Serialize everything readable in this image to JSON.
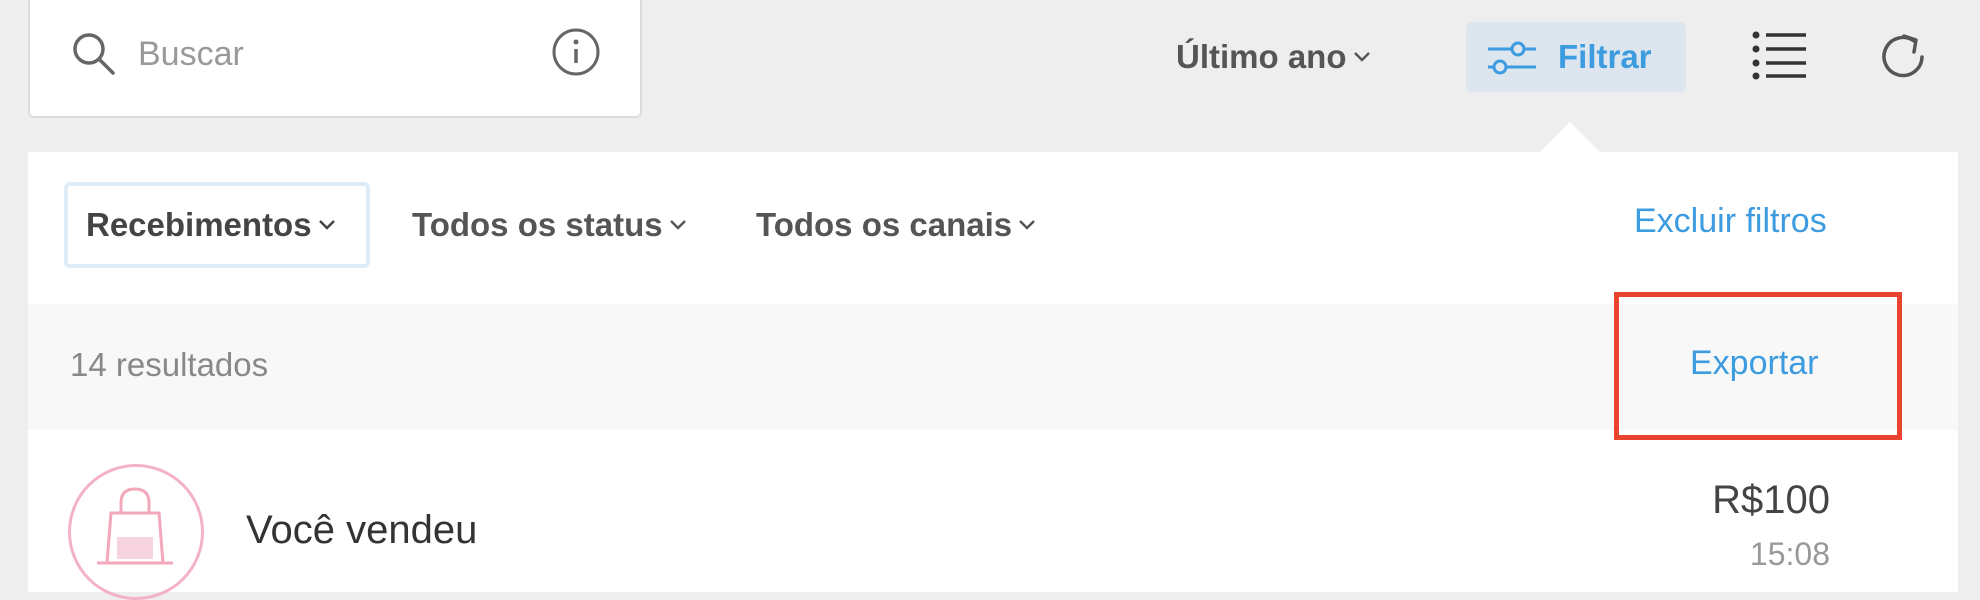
{
  "search": {
    "placeholder": "Buscar"
  },
  "toolbar": {
    "period_label": "Último ano",
    "filter_label": "Filtrar",
    "accent_color": "#3d9be0"
  },
  "filters": {
    "items": [
      {
        "label": "Recebimentos",
        "selected": true
      },
      {
        "label": "Todos os status",
        "selected": false
      },
      {
        "label": "Todos os canais",
        "selected": false
      }
    ],
    "clear_label": "Excluir filtros"
  },
  "results": {
    "count_label": "14 resultados",
    "export_label": "Exportar",
    "highlight_color": "#e8442f"
  },
  "transactions": [
    {
      "icon": "shopping-bag-icon",
      "title": "Você vendeu",
      "amount": "R$100",
      "time": "15:08"
    }
  ]
}
